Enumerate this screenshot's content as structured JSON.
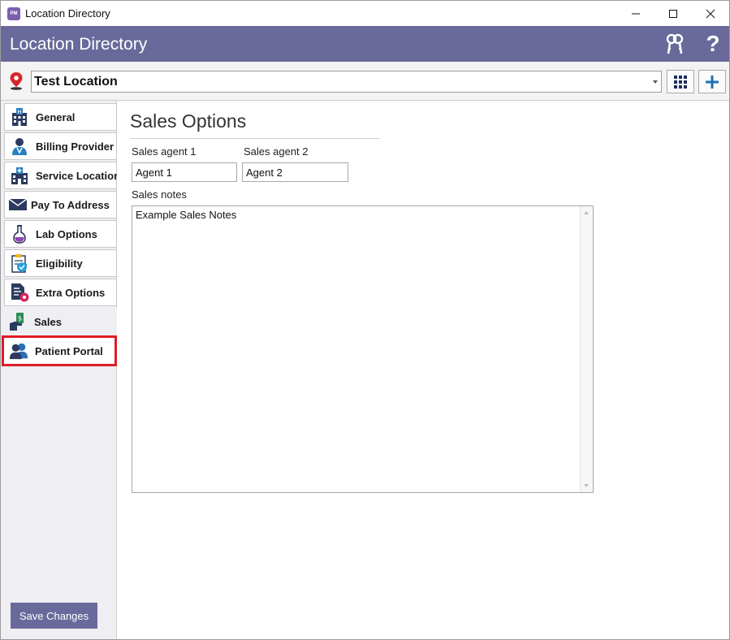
{
  "window": {
    "title": "Location Directory",
    "app_icon_text": "PM"
  },
  "header": {
    "title": "Location Directory",
    "help_glyph": "?"
  },
  "location": {
    "selected": "Test Location"
  },
  "sidebar": {
    "items": [
      {
        "label": "General",
        "icon": "hospital-icon"
      },
      {
        "label": "Billing Provider",
        "icon": "doctor-icon"
      },
      {
        "label": "Service Location",
        "icon": "building-icon"
      },
      {
        "label": "Pay To Address",
        "icon": "envelope-icon"
      },
      {
        "label": "Lab Options",
        "icon": "flask-icon"
      },
      {
        "label": "Eligibility",
        "icon": "clipboard-shield-icon"
      },
      {
        "label": "Extra Options",
        "icon": "document-gear-icon"
      },
      {
        "label": "Sales",
        "icon": "money-hand-icon"
      },
      {
        "label": "Patient Portal",
        "icon": "people-icon"
      }
    ],
    "active": "Sales",
    "highlighted": "Patient Portal",
    "save_label": "Save Changes"
  },
  "main": {
    "section_title": "Sales Options",
    "agent1_label": "Sales agent 1",
    "agent1_value": "Agent 1",
    "agent2_label": "Sales agent 2",
    "agent2_value": "Agent 2",
    "notes_label": "Sales notes",
    "notes_value": "Example Sales Notes"
  },
  "colors": {
    "header": "#696a9b",
    "accent_blue": "#1f6fb3",
    "highlight_red": "#e01b24"
  }
}
